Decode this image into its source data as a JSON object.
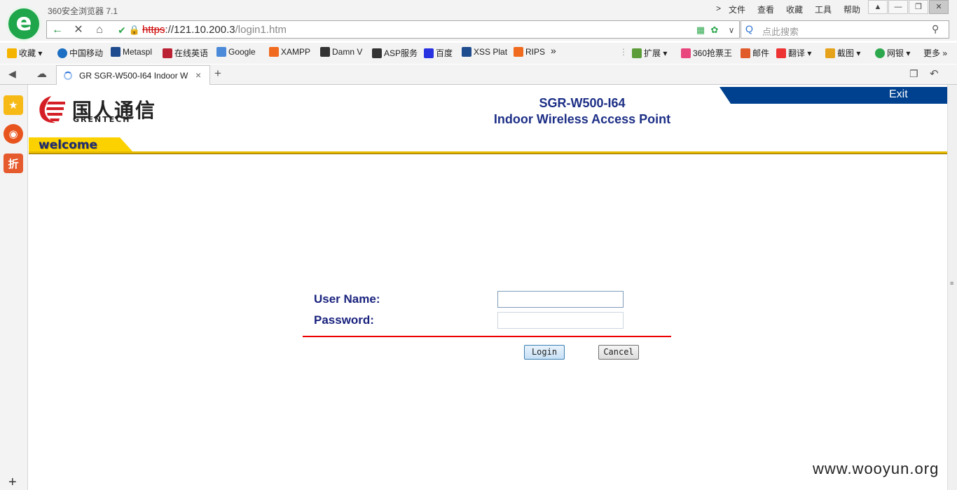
{
  "browser": {
    "app_title": "360安全浏览器 7.1",
    "menu": [
      "文件",
      "查看",
      "收藏",
      "工具",
      "帮助"
    ],
    "url": {
      "scheme": "https",
      "sep": "://",
      "host": "121.10.200.3",
      "path": "/login1.htm"
    },
    "search_placeholder": "点此搜索",
    "bookmarks": [
      "收藏",
      "中国移动",
      "Metaspl",
      "在线英语",
      "Google",
      "XAMPP",
      "Damn V",
      "ASP服务",
      "百度",
      "XSS Plat",
      "RIPS"
    ],
    "bookmarks_overflow": "»",
    "toolbar_right": [
      "扩展",
      "360抢票王",
      "邮件",
      "翻译",
      "截图",
      "网银",
      "更多"
    ],
    "tab_title": "GR SGR-W500-I64 Indoor W",
    "sidebar_badge": "折"
  },
  "page": {
    "brand_cn": "国人通信",
    "brand_en": "GRENTECH",
    "product_model": "SGR-W500-I64",
    "product_desc": "Indoor Wireless Access Point",
    "exit_label": "Exit",
    "welcome_label": "welcome",
    "form": {
      "username_label": "User Name:",
      "password_label": "Password:",
      "username_value": "",
      "password_value": "",
      "login_label": "Login",
      "cancel_label": "Cancel"
    }
  },
  "watermark": "www.wooyun.org",
  "colors": {
    "accent_blue": "#00418f",
    "title_blue": "#1d2f86",
    "welcome_gold": "#fbd200",
    "rule_red": "#e00000"
  }
}
